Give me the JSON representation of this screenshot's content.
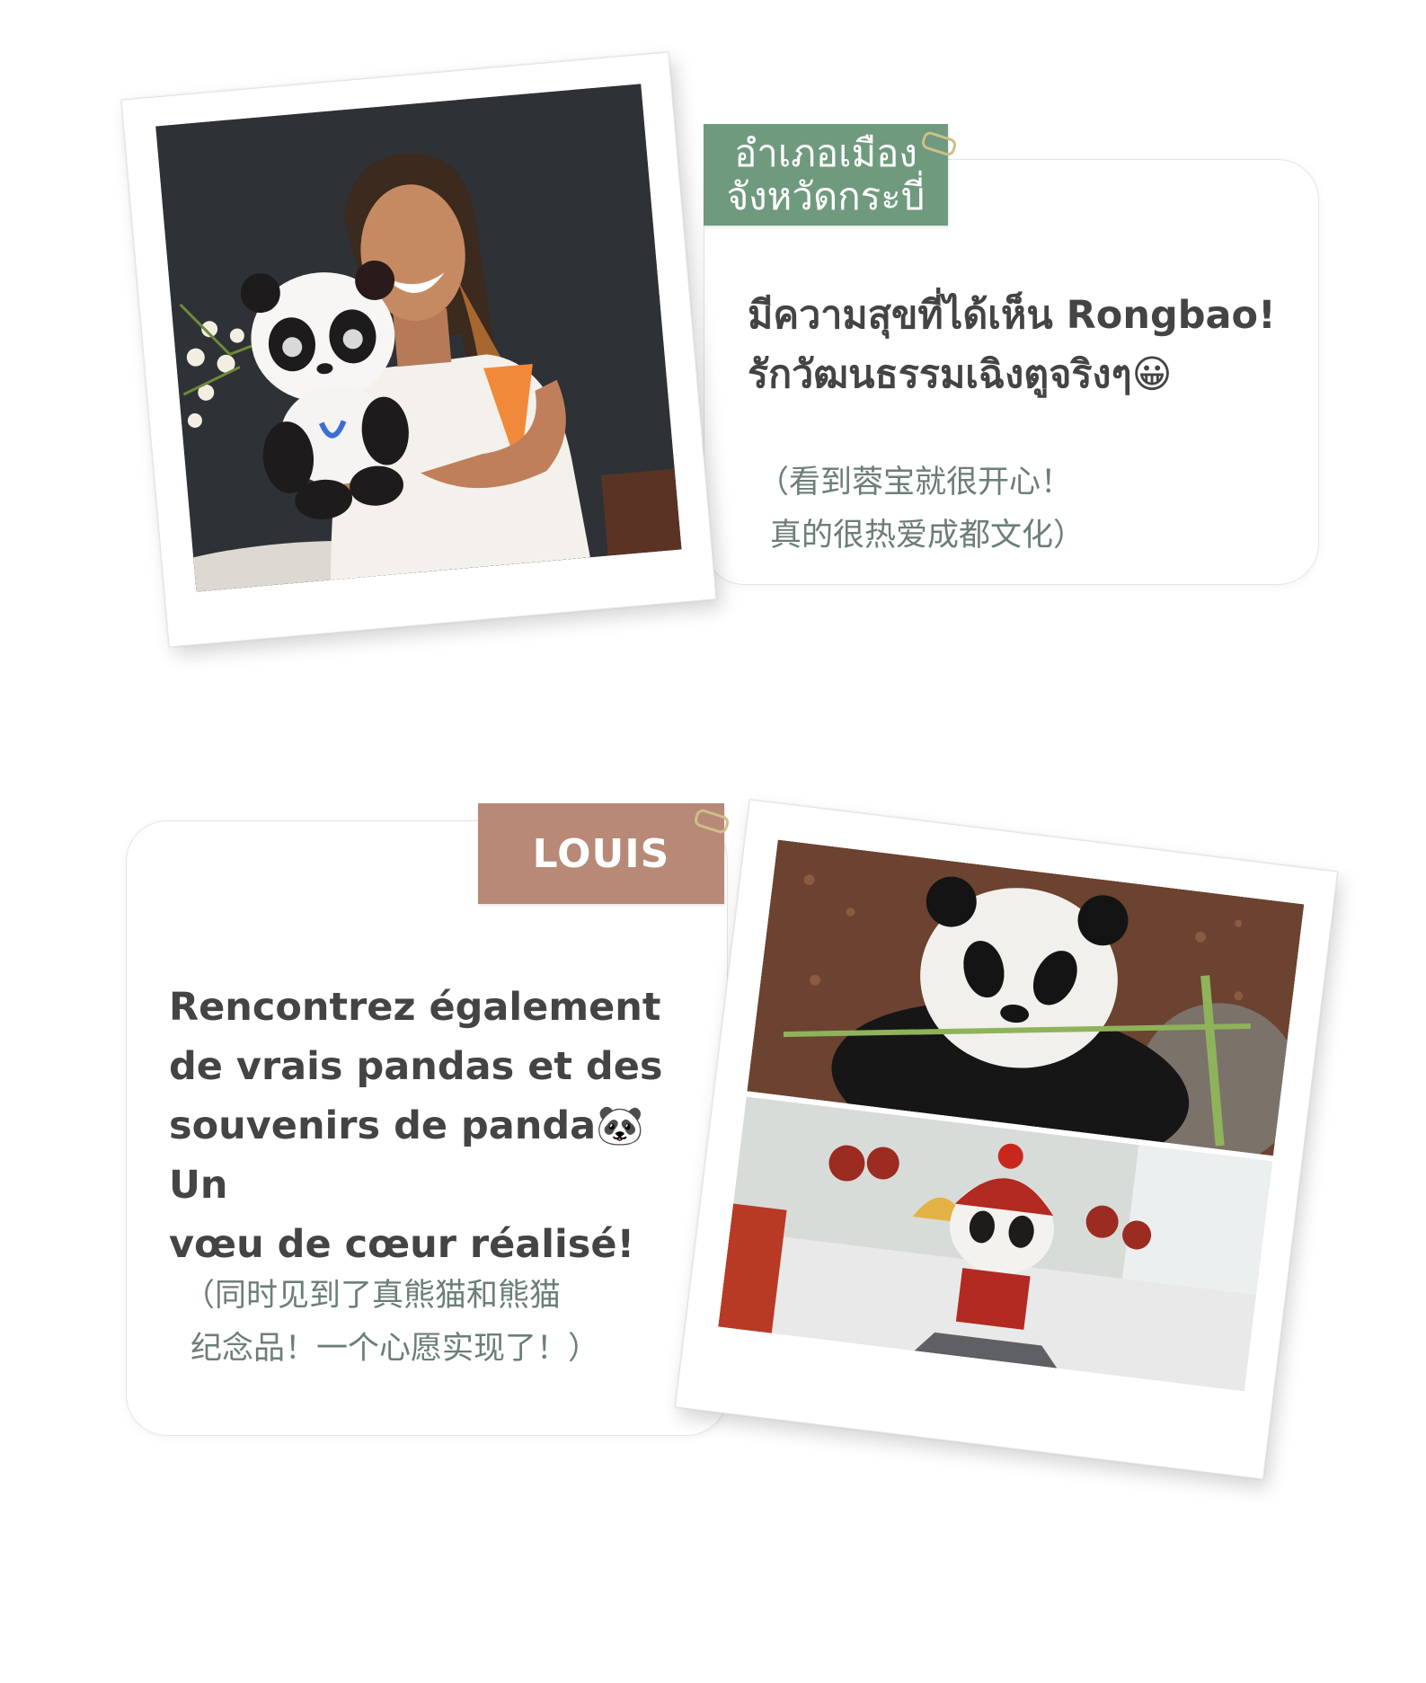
{
  "entry1": {
    "tag_label": "อำเภอเมือง จังหวัดกระบี่",
    "message_line1": "มีความสุขที่ได้เห็น Rongbao!",
    "message_line2": "รักวัฒนธรรมเฉิงตูจริงๆ😀",
    "translation_line1": "（看到蓉宝就很开心！",
    "translation_line2": "真的很热爱成都文化）"
  },
  "entry2": {
    "tag_label": "LOUIS",
    "message_line1": "Rencontrez également",
    "message_line2": "de vrais pandas et des",
    "message_line3": "souvenirs de panda🐼Un",
    "message_line4": "vœu de cœur réalisé!",
    "translation_line1": "（同时见到了真熊猫和熊猫",
    "translation_line2": "纪念品！一个心愿实现了！）"
  },
  "colors": {
    "tag_green": "#6f9a7e",
    "tag_brown": "#b88977",
    "message_text": "#444444",
    "translation_text": "#6c7e78"
  }
}
